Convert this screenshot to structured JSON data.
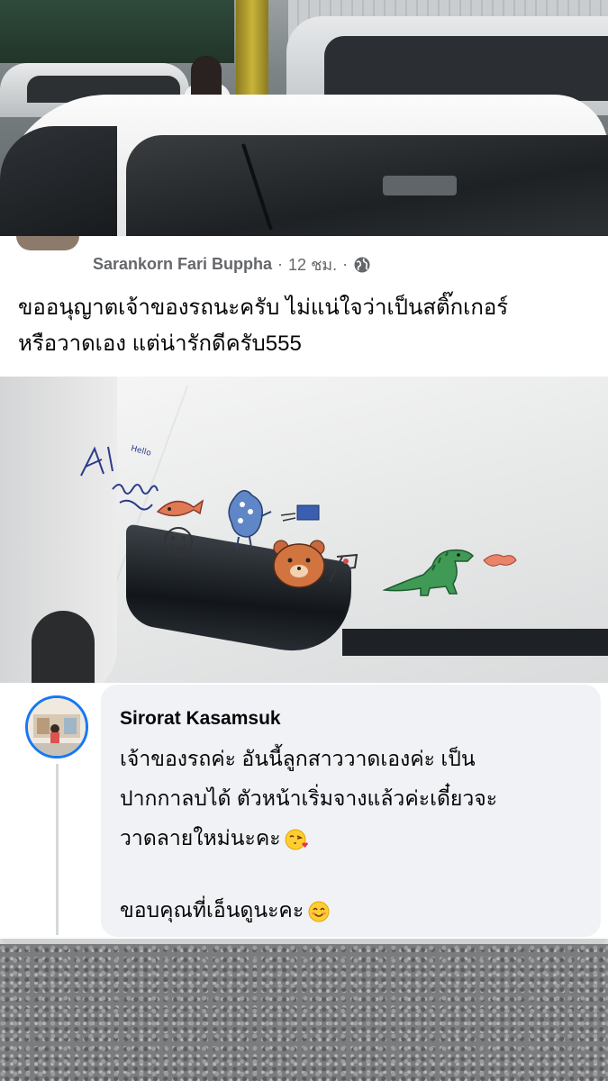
{
  "post": {
    "author": "Sarankorn Fari Buppha",
    "time": "12 ชม.",
    "separator": "·",
    "text_line1": "ขออนุญาตเจ้าของรถนะครับ ไม่แน่ใจว่าเป็นสติ๊กเกอร์",
    "text_line2": "หรือวาดเอง แต่น่ารักดีครับ555"
  },
  "comment": {
    "author": "Sirorat Kasamsuk",
    "line1": "เจ้าของรถค่ะ อันนี้ลูกสาววาดเองค่ะ เป็น",
    "line2": "ปากกาลบได้ ตัวหน้าเริ่มจางแล้วค่ะเดี๋ยวจะ",
    "line3": "วาดลายใหม่นะคะ",
    "line4": "ขอบคุณที่เอ็นดูนะคะ",
    "emoji1": "face-blowing-kiss-icon",
    "emoji2": "smiling-face-icon"
  },
  "doodles": {
    "hello_text": "Hello"
  },
  "colors": {
    "accent_blue": "#1877f2",
    "meta_gray": "#65676b",
    "text_black": "#050505",
    "bubble_bg": "#f0f2f5"
  }
}
